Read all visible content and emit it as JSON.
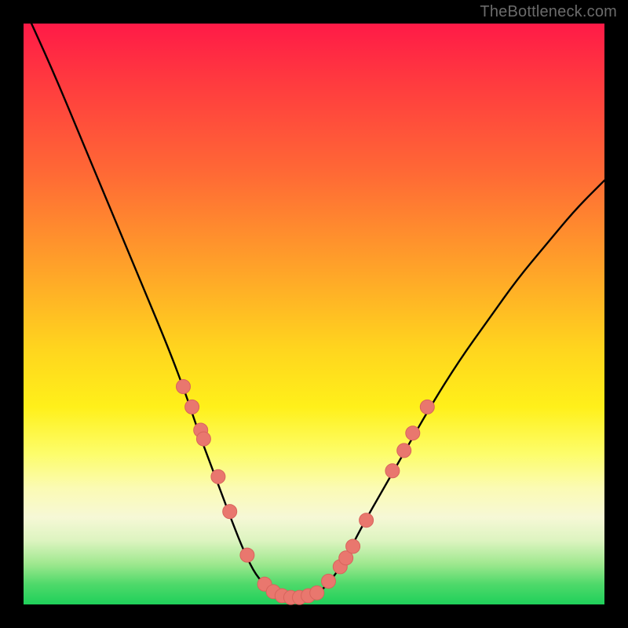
{
  "watermark": "TheBottleneck.com",
  "colors": {
    "frame": "#000000",
    "curve": "#000000",
    "dot_fill": "#e9776e",
    "dot_stroke": "#d8645c",
    "gradient_top": "#ff1a47",
    "gradient_bottom": "#1fd05a"
  },
  "chart_data": {
    "type": "line",
    "title": "",
    "xlabel": "",
    "ylabel": "",
    "x": [
      0.0,
      0.05,
      0.1,
      0.15,
      0.2,
      0.25,
      0.28,
      0.3,
      0.33,
      0.36,
      0.38,
      0.4,
      0.42,
      0.44,
      0.46,
      0.48,
      0.5,
      0.52,
      0.55,
      0.58,
      0.62,
      0.66,
      0.7,
      0.75,
      0.8,
      0.85,
      0.9,
      0.95,
      1.0
    ],
    "y": [
      1.03,
      0.92,
      0.8,
      0.68,
      0.56,
      0.44,
      0.36,
      0.3,
      0.22,
      0.14,
      0.09,
      0.05,
      0.03,
      0.015,
      0.01,
      0.01,
      0.015,
      0.03,
      0.07,
      0.13,
      0.2,
      0.27,
      0.34,
      0.42,
      0.49,
      0.56,
      0.62,
      0.68,
      0.73
    ],
    "xlim": [
      0,
      1
    ],
    "ylim": [
      0,
      1
    ],
    "series": [
      {
        "name": "bottleneck-curve",
        "type": "line",
        "color": "#000000"
      },
      {
        "name": "highlight-dots-left",
        "type": "scatter",
        "color": "#e9776e",
        "points": [
          {
            "x": 0.275,
            "y": 0.375
          },
          {
            "x": 0.29,
            "y": 0.34
          },
          {
            "x": 0.305,
            "y": 0.3
          },
          {
            "x": 0.31,
            "y": 0.285
          },
          {
            "x": 0.335,
            "y": 0.22
          },
          {
            "x": 0.355,
            "y": 0.16
          },
          {
            "x": 0.385,
            "y": 0.085
          }
        ]
      },
      {
        "name": "highlight-dots-bottom",
        "type": "scatter",
        "color": "#e9776e",
        "points": [
          {
            "x": 0.415,
            "y": 0.035
          },
          {
            "x": 0.43,
            "y": 0.022
          },
          {
            "x": 0.445,
            "y": 0.015
          },
          {
            "x": 0.46,
            "y": 0.012
          },
          {
            "x": 0.475,
            "y": 0.012
          },
          {
            "x": 0.49,
            "y": 0.015
          },
          {
            "x": 0.505,
            "y": 0.02
          }
        ]
      },
      {
        "name": "highlight-dots-right",
        "type": "scatter",
        "color": "#e9776e",
        "points": [
          {
            "x": 0.525,
            "y": 0.04
          },
          {
            "x": 0.545,
            "y": 0.065
          },
          {
            "x": 0.555,
            "y": 0.08
          },
          {
            "x": 0.567,
            "y": 0.1
          },
          {
            "x": 0.59,
            "y": 0.145
          },
          {
            "x": 0.635,
            "y": 0.23
          },
          {
            "x": 0.655,
            "y": 0.265
          },
          {
            "x": 0.67,
            "y": 0.295
          },
          {
            "x": 0.695,
            "y": 0.34
          }
        ]
      }
    ]
  }
}
